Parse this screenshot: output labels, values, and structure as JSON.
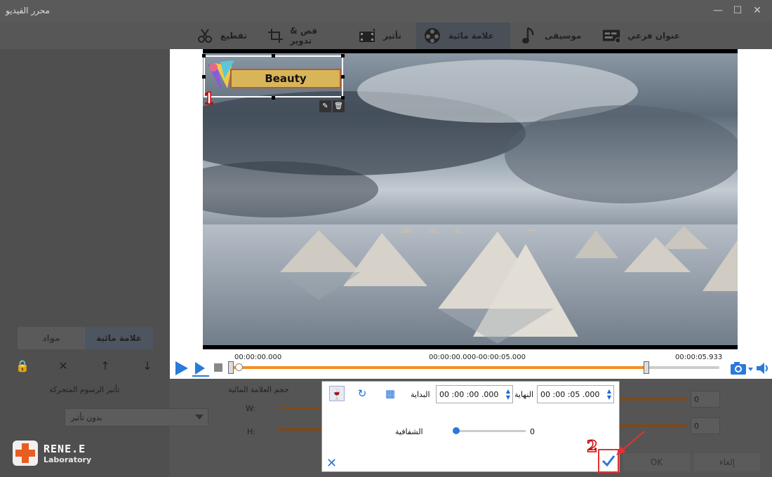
{
  "window": {
    "title": "محرر الفيديو"
  },
  "tabs": [
    {
      "label": "تقطيع",
      "icon": "scissors-icon"
    },
    {
      "label": "قص & تدوير",
      "icon": "crop-icon"
    },
    {
      "label": "تأثير",
      "icon": "effect-icon"
    },
    {
      "label": "علامة مائية",
      "icon": "watermark-film-icon"
    },
    {
      "label": "موسيقى",
      "icon": "music-note-icon"
    },
    {
      "label": "عنوان فرعي",
      "icon": "subtitle-icon"
    }
  ],
  "sidebar": {
    "tab_watermark": "علامة مائية",
    "tab_materials": "مواد"
  },
  "animation": {
    "label": "تأثير الرسوم المتحركة",
    "selected": "بدون تأثير"
  },
  "watermark_size": {
    "label": "حجم العلامة المائية",
    "w_label": "W:",
    "h_label": "H:",
    "w_value": "0",
    "h_value": "0"
  },
  "video": {
    "watermark_text": "Beauty",
    "step1": "1",
    "step2": "2"
  },
  "playback": {
    "start_time": "00:00:00.000",
    "range_time": "00:00:00.000-00:00:05.000",
    "end_time": "00:00:05.933",
    "progress_fraction": 0.85
  },
  "popup": {
    "end_label": "النهاية",
    "end_value": "00 :00 :05 .000",
    "start_label": "البداية",
    "start_value": "00 :00 :00 .000",
    "opacity_label": "الشفافية",
    "opacity_value": "0"
  },
  "buttons": {
    "ok": "OK",
    "cancel": "إلغاء"
  },
  "logo": {
    "name": "RENE.E",
    "sub": "Laboratory"
  },
  "colors": {
    "accent": "#1e6bd0",
    "progress": "#f39020",
    "marker_red": "#e53030"
  }
}
